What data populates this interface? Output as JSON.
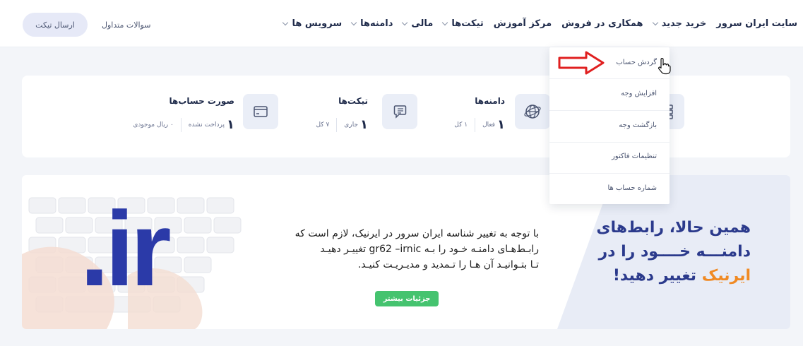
{
  "navbar": {
    "items": [
      {
        "label": "سرویس ها",
        "has_chevron": true
      },
      {
        "label": "دامنه‌ها",
        "has_chevron": true
      },
      {
        "label": "مالی",
        "has_chevron": true
      },
      {
        "label": "تیکت‌ها",
        "has_chevron": true
      },
      {
        "label": "مرکز آموزش",
        "has_chevron": false
      },
      {
        "label": "همکاری در فروش",
        "has_chevron": false
      },
      {
        "label": "خرید جدید",
        "has_chevron": true
      },
      {
        "label": "سایت ایران سرور",
        "has_chevron": false
      }
    ],
    "faq_label": "سوالات متداول",
    "ticket_button_label": "ارسال تیکت"
  },
  "stats": {
    "domains": {
      "title": "دامنه‌ها",
      "active_num": "۱",
      "active_label": "فعال",
      "total_label": "۱ کل",
      "icon": "globe-icon"
    },
    "tickets": {
      "title": "تیکت‌ها",
      "open_num": "۱",
      "open_label": "جاری",
      "total_label": "۷ کل",
      "icon": "chat-icon"
    },
    "invoices": {
      "title": "صورت حساب‌ها",
      "unpaid_num": "۱",
      "unpaid_label": "پرداخت نشده",
      "balance_label": "۰ ریال موجودی",
      "icon": "card-icon"
    },
    "services": {
      "icon": "server-icon"
    }
  },
  "finance_dropdown": {
    "items": [
      "گردش حساب",
      "افزایش وجه",
      "بازگشت وجه",
      "تنظیمات فاکتور",
      "شماره حساب ها"
    ]
  },
  "banner": {
    "headline_line1": "همین حالا، رابط‌های",
    "headline_line2": "دامنـــه خــــود را در",
    "headline_brand": "ایرنیک",
    "headline_line3_rest": "تغییر دهید!",
    "body_line1": "با توجه به تغییر شناسه ایران سرور در ایرنیک، لازم است که",
    "body_line2": "رابـط‌هـای دامنـه خـود را بـه gr62 –irnic تغییـر دهیـد",
    "body_line3": "تـا بتـوانیـد آن هـا را تـمدید و مدیـریـت کنیـد.",
    "button_label": "جزئیات بیشتر",
    "logo_text": ".ir"
  },
  "colors": {
    "brand_blue": "#2b3a8c",
    "accent_orange": "#f08a24",
    "button_green": "#45c36f",
    "arrow_red": "#e02020"
  }
}
